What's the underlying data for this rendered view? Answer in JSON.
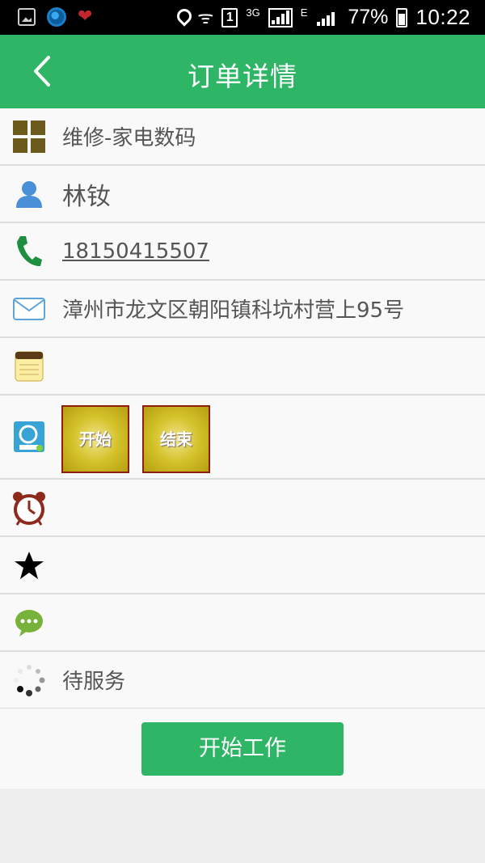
{
  "status_bar": {
    "network_type": "3G",
    "data_type": "E",
    "battery": "77%",
    "time": "10:22"
  },
  "header": {
    "title": "订单详情"
  },
  "order": {
    "category": "维修-家电数码",
    "customer_name": "林钕",
    "phone": "18150415507",
    "address": "漳州市龙文区朝阳镇科坑村营上95号",
    "note": "",
    "timer_buttons": {
      "start_label": "开始",
      "end_label": "结束"
    },
    "alarm_value": "",
    "rating_value": "",
    "comment_value": "",
    "status": "待服务"
  },
  "actions": {
    "start_work_label": "开始工作"
  },
  "colors": {
    "accent": "#2eb566",
    "divider": "#dddddd",
    "text": "#555555"
  }
}
